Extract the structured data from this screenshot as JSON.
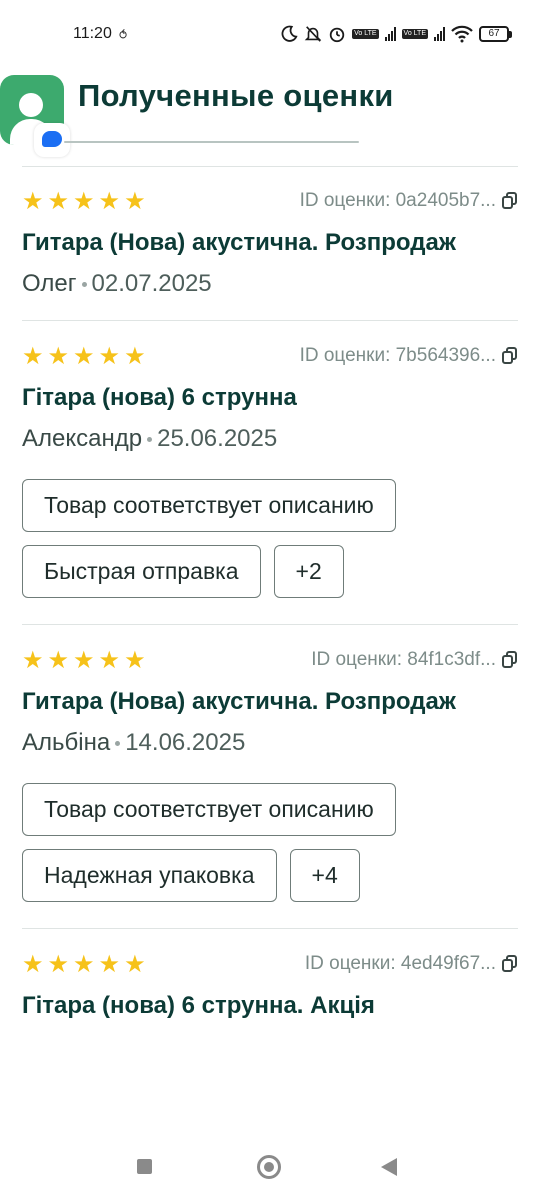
{
  "status_bar": {
    "time": "11:20",
    "battery": "67",
    "volte1": "Vo LTE",
    "volte2": "Vo LTE"
  },
  "header": {
    "title": "Полученные оценки"
  },
  "id_prefix": "ID оценки: ",
  "reviews": [
    {
      "rating": 5,
      "review_id": "ID оценки: 0a2405b7...",
      "product": "Гитара (Нова) акустична. Розпродаж",
      "author": "Олег",
      "date": "02.07.2025",
      "tags": []
    },
    {
      "rating": 5,
      "review_id": "ID оценки: 7b564396...",
      "product": "Гітара (нова) 6 струнна",
      "author": "Александр",
      "date": "25.06.2025",
      "tags": [
        "Товар соответствует описанию",
        "Быстрая отправка",
        "+2"
      ]
    },
    {
      "rating": 5,
      "review_id": "ID оценки: 84f1c3df...",
      "product": "Гитара (Нова) акустична. Розпродаж",
      "author": "Альбіна",
      "date": "14.06.2025",
      "tags": [
        "Товар соответствует описанию",
        "Надежная упаковка",
        "+4"
      ]
    },
    {
      "rating": 5,
      "review_id": "ID оценки: 4ed49f67...",
      "product": "Гітара (нова) 6 струнна. Акція",
      "author": "",
      "date": "",
      "tags": []
    }
  ],
  "colors": {
    "star": "#f6c21a",
    "title": "#0c3b36",
    "avatar_green": "#3daa6e",
    "badge_blue": "#1b6ef3"
  },
  "icons": [
    "moon-icon",
    "bell-off-icon",
    "alarm-icon",
    "signal-icon",
    "wifi-icon",
    "battery-icon",
    "copy-icon",
    "star-icon"
  ]
}
